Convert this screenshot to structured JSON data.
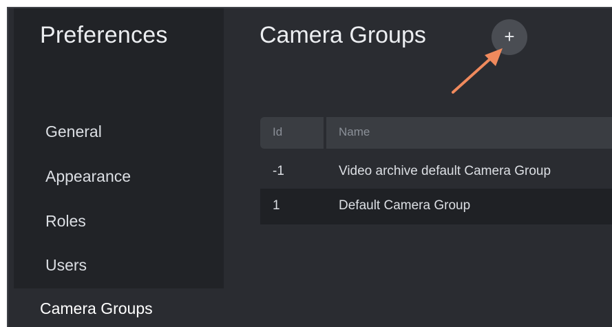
{
  "sidebar": {
    "title": "Preferences",
    "items": [
      {
        "label": "General"
      },
      {
        "label": "Appearance"
      },
      {
        "label": "Roles"
      },
      {
        "label": "Users"
      },
      {
        "label": "Camera Groups"
      }
    ],
    "selected": "Camera Groups"
  },
  "main": {
    "title": "Camera Groups",
    "add_label": "+",
    "table": {
      "columns": [
        "Id",
        "Name"
      ],
      "rows": [
        {
          "id": "-1",
          "name": "Video archive default Camera Group"
        },
        {
          "id": "1",
          "name": "Default Camera Group"
        }
      ]
    }
  },
  "annotation": {
    "arrow_color": "#f08a5d"
  }
}
